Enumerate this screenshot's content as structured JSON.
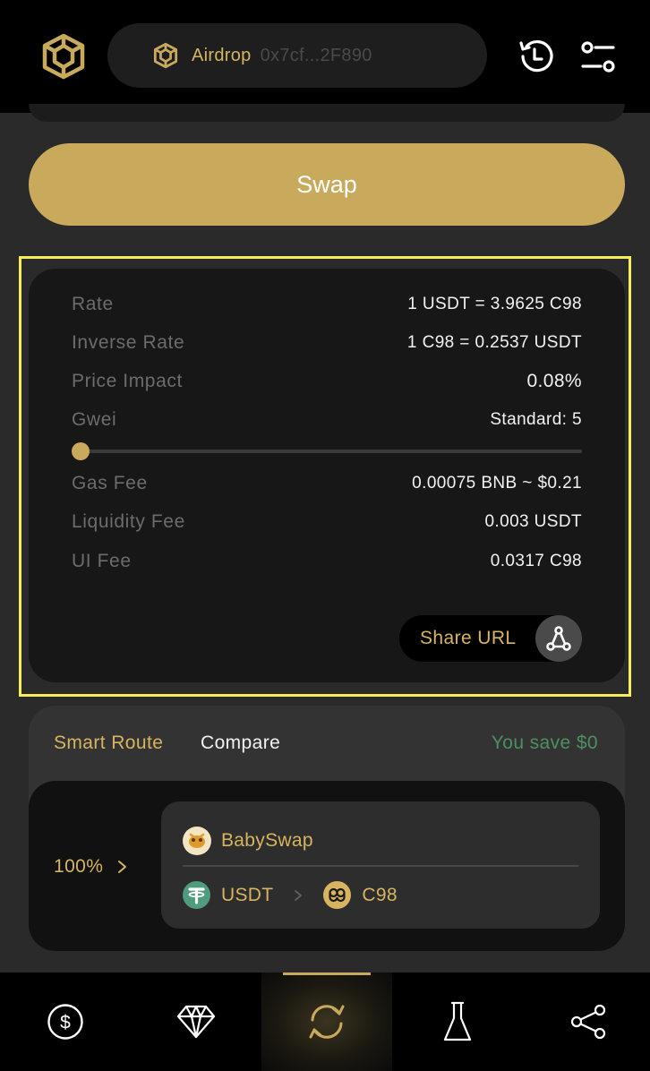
{
  "header": {
    "wallet_name": "Airdrop",
    "wallet_address": "0x7cf...2F890",
    "logo_icon": "binance-cube-icon",
    "history_icon": "history-icon",
    "settings_icon": "sliders-icon"
  },
  "swap_button_label": "Swap",
  "details": {
    "rows_top": [
      {
        "key": "Rate",
        "value": "1 USDT = 3.9625 C98"
      },
      {
        "key": "Inverse Rate",
        "value": "1 C98 = 0.2537 USDT"
      },
      {
        "key": "Price Impact",
        "value": "0.08%"
      },
      {
        "key": "Gwei",
        "value": "Standard: 5"
      }
    ],
    "gwei_slider_level": 0,
    "rows_bottom": [
      {
        "key": "Gas Fee",
        "value": "0.00075 BNB ~ $0.21"
      },
      {
        "key": "Liquidity Fee",
        "value": "0.003 USDT"
      },
      {
        "key": "UI Fee",
        "value": "0.0317 C98"
      }
    ],
    "share_label": "Share URL",
    "share_icon": "share-network-icon"
  },
  "route": {
    "tab_smart": "Smart Route",
    "tab_compare": "Compare",
    "save_text": "You save $0",
    "percent": "100%",
    "pool_name": "BabySwap",
    "from_token": "USDT",
    "to_token": "C98"
  },
  "nav": {
    "items": [
      {
        "icon": "dollar-icon"
      },
      {
        "icon": "diamond-icon"
      },
      {
        "icon": "swap-icon",
        "active": true
      },
      {
        "icon": "flask-icon"
      },
      {
        "icon": "share-icon"
      }
    ]
  },
  "colors": {
    "accent": "#c9a95c",
    "highlight": "#f5ee5a",
    "save_green": "#4d8f62"
  }
}
